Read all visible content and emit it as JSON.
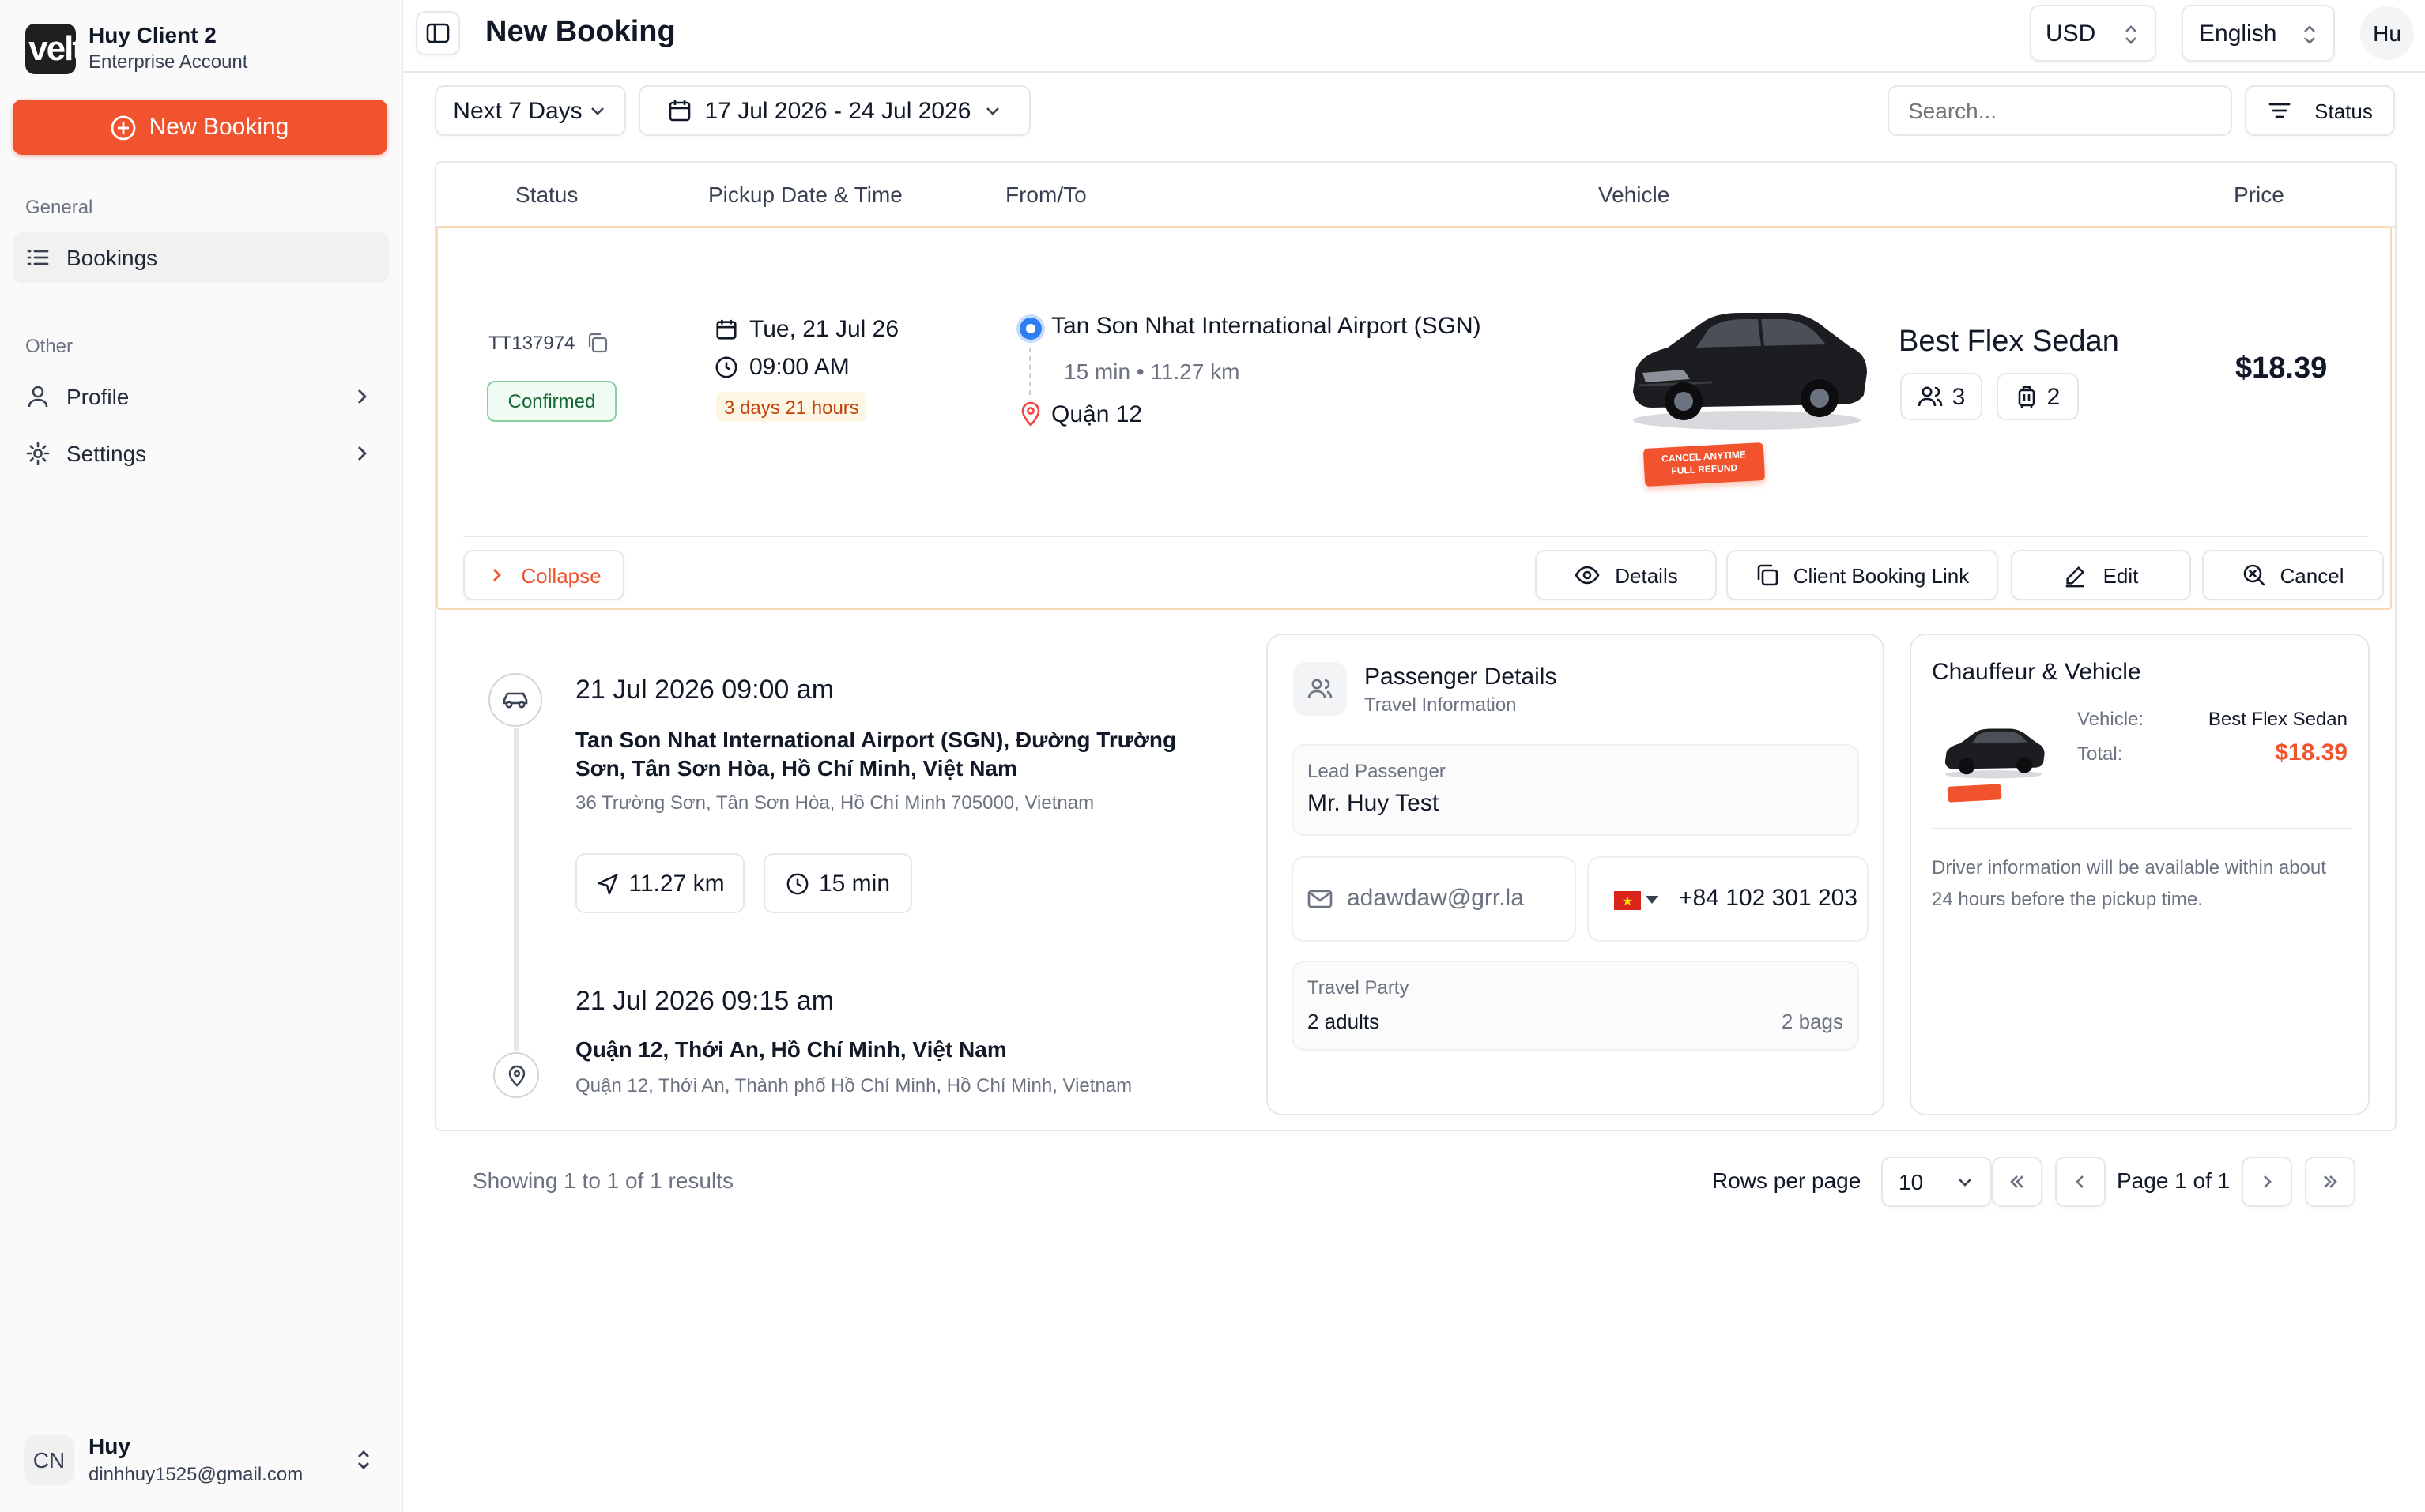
{
  "sidebar": {
    "logo_text": "velt",
    "account_name": "Huy Client 2",
    "account_type": "Enterprise Account",
    "new_booking_label": "New Booking",
    "section_general": "General",
    "section_other": "Other",
    "items": [
      {
        "label": "Bookings",
        "icon": "list-icon"
      },
      {
        "label": "Profile",
        "icon": "user-icon"
      },
      {
        "label": "Settings",
        "icon": "gear-icon"
      }
    ],
    "user": {
      "initials": "CN",
      "name": "Huy",
      "email": "dinhhuy1525@gmail.com"
    }
  },
  "header": {
    "title": "New Booking",
    "currency": "USD",
    "language": "English",
    "avatar_text": "Hu"
  },
  "filters": {
    "range_preset": "Next 7 Days",
    "date_range": "17 Jul 2026 - 24 Jul 2026",
    "search_placeholder": "Search...",
    "status_label": "Status"
  },
  "table": {
    "columns": [
      "Status",
      "Pickup Date & Time",
      "From/To",
      "Vehicle",
      "Price"
    ]
  },
  "booking": {
    "id": "TT137974",
    "status": "Confirmed",
    "pickup_date": "Tue, 21 Jul 26",
    "pickup_time": "09:00 AM",
    "countdown": "3 days 21 hours",
    "from": "Tan Son Nhat International Airport (SGN)",
    "trip_meta": "15 min • 11.27 km",
    "to": "Quận 12",
    "vehicle_name": "Best Flex Sedan",
    "passengers": "3",
    "bags": "2",
    "badge_line1": "CANCEL ANYTIME",
    "badge_line2": "FULL REFUND",
    "price": "$18.39",
    "actions": {
      "collapse": "Collapse",
      "details": "Details",
      "client_link": "Client Booking Link",
      "edit": "Edit",
      "cancel": "Cancel"
    }
  },
  "itinerary": {
    "pickup_datetime": "21 Jul 2026 09:00 am",
    "pickup_address": "Tan Son Nhat International Airport (SGN), Đường Trường Sơn, Tân Sơn Hòa, Hồ Chí Minh, Việt Nam",
    "pickup_detail": "36 Trường Sơn, Tân Sơn Hòa, Hồ Chí Minh 705000, Vietnam",
    "distance": "11.27 km",
    "duration": "15 min",
    "dropoff_datetime": "21 Jul 2026 09:15 am",
    "dropoff_address": "Quận 12, Thới An, Hồ Chí Minh, Việt Nam",
    "dropoff_detail": "Quận 12, Thới An, Thành phố Hồ Chí Minh, Hồ Chí Minh, Vietnam"
  },
  "passenger": {
    "title": "Passenger Details",
    "subtitle": "Travel Information",
    "lead_label": "Lead Passenger",
    "lead_name": "Mr. Huy Test",
    "email": "adawdaw@grr.la",
    "phone": "+84 102 301 203",
    "party_label": "Travel Party",
    "adults": "2 adults",
    "bags": "2 bags"
  },
  "chauffeur": {
    "title": "Chauffeur & Vehicle",
    "vehicle_label": "Vehicle:",
    "vehicle_value": "Best Flex Sedan",
    "total_label": "Total:",
    "total_value": "$18.39",
    "note": "Driver information will be available within about 24 hours before the pickup time."
  },
  "pagination": {
    "summary": "Showing 1 to 1 of 1 results",
    "rows_label": "Rows per page",
    "rows_value": "10",
    "page_label": "Page 1 of 1"
  },
  "colors": {
    "accent": "#f0532d",
    "confirmed_green": "#15803d",
    "countdown_orange": "#c2410c"
  }
}
